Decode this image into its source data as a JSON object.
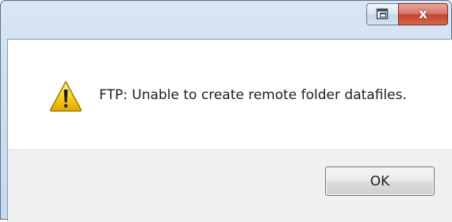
{
  "window": {
    "title": ""
  },
  "caption_buttons": {
    "restore_icon": "restore-icon",
    "close_label": "x",
    "close_color": "#c4452f"
  },
  "dialog": {
    "icon": "warning-icon",
    "icon_color": "#f5c400",
    "message": "FTP: Unable to create remote folder datafiles."
  },
  "buttons": {
    "ok_label": "OK"
  }
}
